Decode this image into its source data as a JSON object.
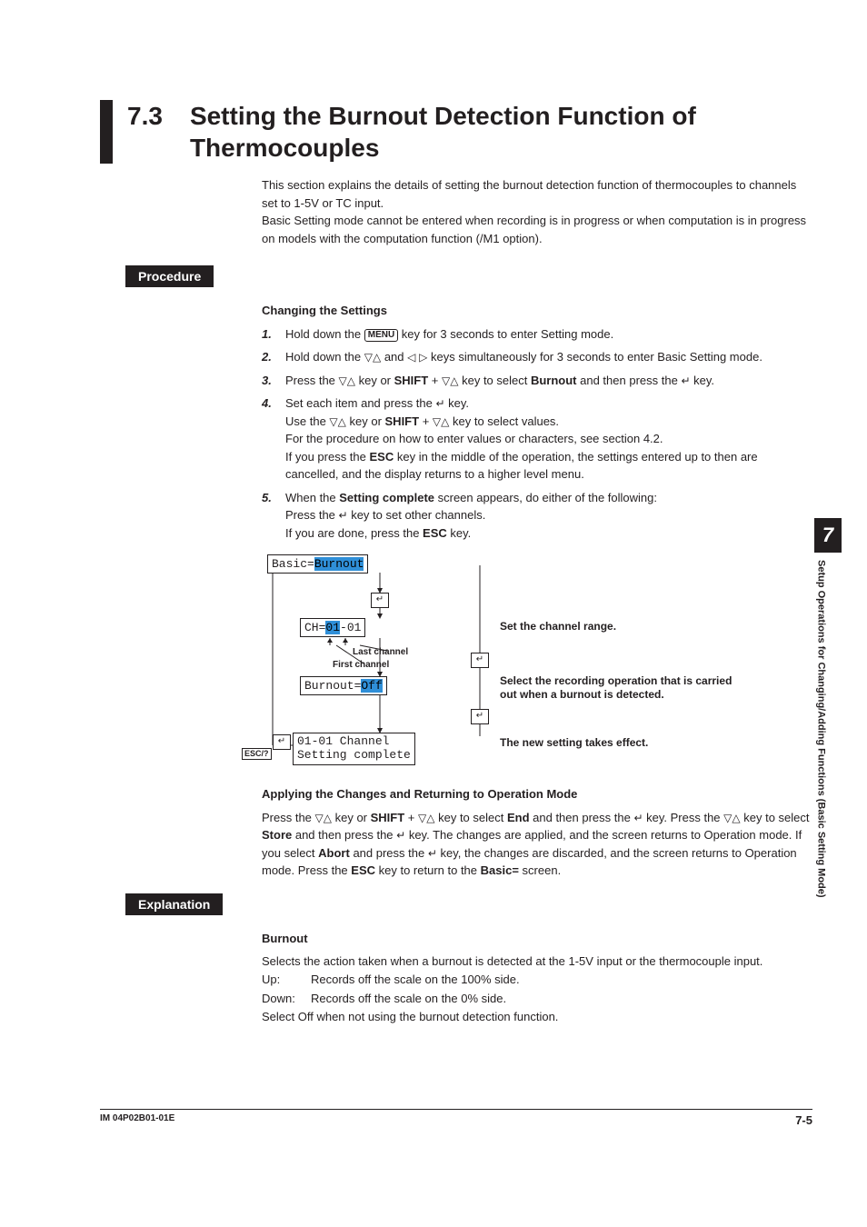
{
  "header": {
    "section_number": "7.3",
    "title": "Setting the Burnout Detection Function of Thermocouples"
  },
  "intro": {
    "p1": "This section explains the details of setting the burnout detection function of thermocouples to channels set to 1-5V or TC input.",
    "p2": "Basic Setting mode cannot be entered when recording is in progress or when computation is in progress on models with the computation function (/M1 option)."
  },
  "labels": {
    "procedure": "Procedure",
    "explanation": "Explanation"
  },
  "procedure": {
    "changing_heading": "Changing the Settings",
    "steps": {
      "s1": {
        "num": "1.",
        "a": "Hold down the ",
        "menu": "MENU",
        "b": " key for 3 seconds to enter Setting mode."
      },
      "s2": {
        "num": "2.",
        "a": "Hold down the ",
        "b": " and ",
        "c": " keys simultaneously for 3 seconds to enter Basic Setting mode."
      },
      "s3": {
        "num": "3.",
        "a": "Press the ",
        "b": " key or ",
        "shift": "SHIFT",
        "c": " + ",
        "d": " key to select ",
        "burnout": "Burnout",
        "e": " and then press the ",
        "f": " key."
      },
      "s4": {
        "num": "4.",
        "l1a": "Set each item and press the ",
        "l1b": " key.",
        "l2a": "Use the ",
        "l2shift": "SHIFT",
        "l2b": " key or ",
        "l2c": " + ",
        "l2d": " key to select values.",
        "l3": "For the procedure on how to enter values or characters, see section 4.2.",
        "l4a": "If you press the ",
        "l4esc": "ESC",
        "l4b": " key in the middle of the operation, the settings entered up to then are cancelled, and the display returns to a higher level menu."
      },
      "s5": {
        "num": "5.",
        "l1a": "When the ",
        "l1b": "Setting complete",
        "l1c": " screen appears, do either of the following:",
        "l2a": "Press the ",
        "l2b": " key to set other channels.",
        "l3a": "If you are done, press the ",
        "l3esc": "ESC",
        "l3b": " key."
      }
    },
    "applying_heading": "Applying the Changes and Returning to Operation Mode",
    "applying": {
      "a": "Press the ",
      "b": " key or ",
      "shift": "SHIFT",
      "c": " + ",
      "d": " key to select ",
      "end": "End",
      "e": " and then press the ",
      "f": " key. Press the ",
      "g": " key to select ",
      "store": "Store",
      "h": " and then press the ",
      "i": " key. The changes are applied, and the screen returns to Operation mode. If you select ",
      "abort": "Abort",
      "j": " and press the ",
      "k": " key, the changes are discarded, and the screen returns to Operation mode. Press the ",
      "esc": "ESC",
      "l": " key to return to the ",
      "basic": "Basic=",
      "m": " screen."
    }
  },
  "diagram": {
    "n1_pre": "Basic=",
    "n1_hl": "Burnout",
    "n2_pre": "CH=",
    "n2_hl": "01",
    "n2_post": "-01",
    "n3_pre": "Burnout=",
    "n3_hl": "Off",
    "n4_l1": "01-01 Channel",
    "n4_l2": "Setting complete",
    "last_channel": "Last channel",
    "first_channel": "First channel",
    "esc_label": "ESC/?",
    "ann1": "Set the channel range.",
    "ann2": "Select the recording operation that is carried out when a burnout is detected.",
    "ann3": "The new setting takes effect."
  },
  "explanation": {
    "heading": "Burnout",
    "p1": "Selects the action taken when a burnout is detected at the 1-5V input or the thermocouple input.",
    "up_label": "Up:",
    "up_text": "Records off the scale on the 100% side.",
    "down_label": "Down:",
    "down_text": "Records off the scale on the 0% side.",
    "p2": "Select Off when not using the burnout detection function."
  },
  "side": {
    "chapter": "7",
    "text": "Setup Operations for Changing/Adding Functions (Basic Setting Mode)"
  },
  "footer": {
    "left": "IM 04P02B01-01E",
    "right": "7-5"
  },
  "glyphs": {
    "updown": "▽△",
    "leftright": "◁ ▷",
    "enter": "↵"
  }
}
